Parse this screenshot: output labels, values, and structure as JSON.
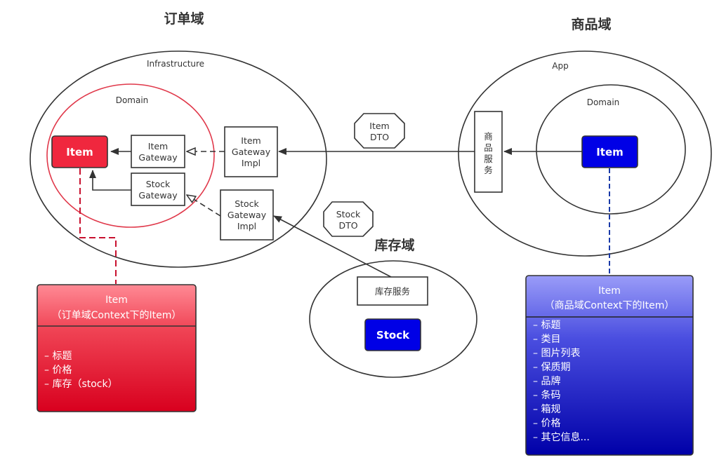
{
  "domains": {
    "order": {
      "title": "订单域",
      "outer_label": "Infrastructure",
      "inner_label": "Domain"
    },
    "product": {
      "title": "商品域",
      "outer_label": "App",
      "inner_label": "Domain"
    },
    "stock": {
      "title": "库存域"
    }
  },
  "nodes": {
    "order_item": {
      "label": "Item"
    },
    "item_gateway": {
      "lines": [
        "Item",
        "Gateway"
      ]
    },
    "stock_gateway": {
      "lines": [
        "Stock",
        "Gateway"
      ]
    },
    "item_gateway_impl": {
      "lines": [
        "Item",
        "Gateway",
        "Impl"
      ]
    },
    "stock_gateway_impl": {
      "lines": [
        "Stock",
        "Gateway",
        "Impl"
      ]
    },
    "item_dto": {
      "lines": [
        "Item",
        "DTO"
      ]
    },
    "stock_dto": {
      "lines": [
        "Stock",
        "DTO"
      ]
    },
    "product_service": {
      "chars": [
        "商",
        "品",
        "服",
        "务"
      ]
    },
    "product_item": {
      "label": "Item"
    },
    "stock_service": {
      "label": "库存服务"
    },
    "stock_entity": {
      "label": "Stock"
    }
  },
  "cards": {
    "order_item_card": {
      "header": [
        "Item",
        "（订单域Context下的Item）"
      ],
      "fields": [
        "– 标题",
        "– 价格",
        "– 库存（stock）"
      ]
    },
    "product_item_card": {
      "header": [
        "Item",
        "（商品域Context下的Item）"
      ],
      "fields": [
        "– 标题",
        "– 类目",
        "– 图片列表",
        "– 保质期",
        "– 品牌",
        "– 条码",
        "– 箱规",
        "– 价格",
        "– 其它信息..."
      ]
    }
  },
  "colors": {
    "order_red": "#f0273e",
    "product_blue": "#0000e6",
    "line": "#333333"
  }
}
